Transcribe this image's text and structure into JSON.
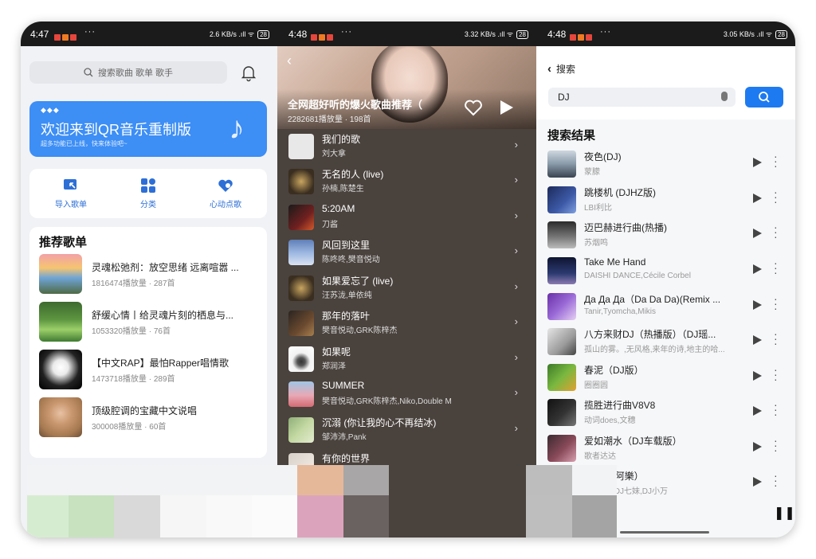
{
  "colors": {
    "accent_blue": "#3d8ef5",
    "button_blue": "#1e7af0",
    "status_bar": "#1b1b1b",
    "dark_panel": "#4a423d"
  },
  "screen1": {
    "status": {
      "time": "4:47",
      "dots": "···",
      "right": "2.6 KB/s .ıll ᯤ",
      "battery": "28"
    },
    "search_placeholder": "搜索歌曲 歌单 歌手",
    "banner": {
      "diamonds": "◆◆◆",
      "title": "欢迎来到QR音乐重制版",
      "subtitle": "超多功能已上线，快来体验吧~"
    },
    "quick": [
      {
        "label": "导入歌单",
        "icon": "import-icon"
      },
      {
        "label": "分类",
        "icon": "grid-icon"
      },
      {
        "label": "心动点歌",
        "icon": "heart-like-icon"
      }
    ],
    "recommend_title": "推荐歌单",
    "playlists": [
      {
        "title": "灵魂松弛剂：放空思绪 远离喧嚣 ...",
        "meta": "1816474播放量 · 287首"
      },
      {
        "title": "舒缓心情丨给灵魂片刻的栖息与...",
        "meta": "1053320播放量 · 76首"
      },
      {
        "title": "【中文RAP】最怕Rapper唱情歌",
        "meta": "1473718播放量 · 289首"
      },
      {
        "title": "顶级腔调的宝藏中文说唱",
        "meta": "300008播放量 · 60首"
      }
    ]
  },
  "screen2": {
    "status": {
      "time": "4:48",
      "dots": "···",
      "right": "3.32 KB/s .ıll ᯤ",
      "battery": "28"
    },
    "hero": {
      "title": "全网超好听的爆火歌曲推荐（",
      "meta": "2282681播放量 · 198首"
    },
    "songs": [
      {
        "title": "我们的歌",
        "artist": "刘大拿"
      },
      {
        "title": "无名的人 (live)",
        "artist": "孙楠,陈楚生"
      },
      {
        "title": "5:20AM",
        "artist": "刀酱"
      },
      {
        "title": "风回到这里",
        "artist": "陈咚咚,樊音悦动"
      },
      {
        "title": "如果爱忘了 (live)",
        "artist": "汪苏泷,单依纯"
      },
      {
        "title": "那年的落叶",
        "artist": "樊音悦动,GRK陈梓杰"
      },
      {
        "title": "如果呢",
        "artist": "郑润泽"
      },
      {
        "title": "SUMMER",
        "artist": "樊音悦动,GRK陈梓杰,Niko,Double M"
      },
      {
        "title": "沉溺 (你让我的心不再结冰)",
        "artist": "邹沛沛,Pank"
      },
      {
        "title": "有你的世界",
        "artist": ""
      }
    ]
  },
  "screen3": {
    "status": {
      "time": "4:48",
      "dots": "···",
      "right": "3.05 KB/s .ıll ᯤ",
      "battery": "28"
    },
    "back_label": "搜索",
    "query": "DJ",
    "results_title": "搜索结果",
    "songs": [
      {
        "title": "夜色(DJ)",
        "artist": "蒙朦"
      },
      {
        "title": "跳楼机 (DJHZ版)",
        "artist": "LBI利比"
      },
      {
        "title": "迈巴赫进行曲(热播)",
        "artist": "苏烟鸣"
      },
      {
        "title": "Take Me Hand",
        "artist": "DAISHI DANCE,Cécile Corbel"
      },
      {
        "title": "Да Да Да（Da Da Da)(Remix ...",
        "artist": "Tanir,Tyomcha,Mikis"
      },
      {
        "title": "八方来财DJ（热播版）（DJ瑶...",
        "artist": "孤山的雾。,无风格,来年的诗,地主的哈..."
      },
      {
        "title": "春泥（DJ版）",
        "artist": "圈圈圆"
      },
      {
        "title": "揽胜进行曲V8V8",
        "artist": "动词does,文穗"
      },
      {
        "title": "爱如潮水（DJ车载版）",
        "artist": "歌者达达"
      },
      {
        "title": "人（DJ阿樂）",
        "artist": "DJ 长情,DJ七妹,DJ小万"
      }
    ]
  }
}
